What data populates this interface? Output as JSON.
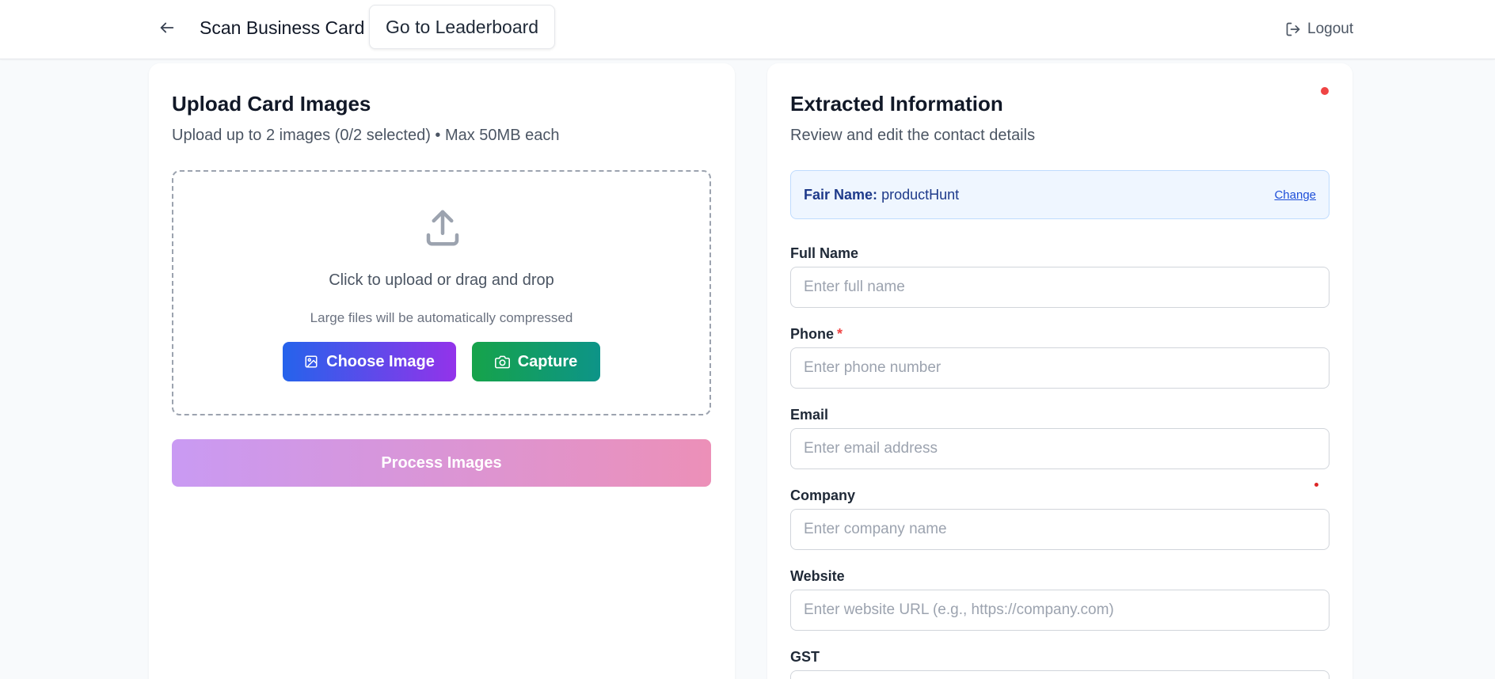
{
  "header": {
    "title": "Scan Business Card",
    "leaderboard_label": "Go to Leaderboard",
    "logout_label": "Logout"
  },
  "upload": {
    "title": "Upload Card Images",
    "subtitle": "Upload up to 2 images (0/2 selected) • Max 50MB each",
    "dropzone_main": "Click to upload or drag and drop",
    "dropzone_hint": "Large files will be automatically compressed",
    "choose_label": "Choose Image",
    "capture_label": "Capture",
    "process_label": "Process Images"
  },
  "extracted": {
    "title": "Extracted Information",
    "subtitle": "Review and edit the contact details",
    "fair_label": "Fair Name:",
    "fair_value": "productHunt",
    "change_label": "Change",
    "fields": [
      {
        "label": "Full Name",
        "placeholder": "Enter full name",
        "value": ""
      },
      {
        "label": "Phone",
        "placeholder": "Enter phone number",
        "value": "",
        "required_mark": "*"
      },
      {
        "label": "Email",
        "placeholder": "Enter email address",
        "value": ""
      },
      {
        "label": "Company",
        "placeholder": "Enter company name",
        "value": ""
      },
      {
        "label": "Website",
        "placeholder": "Enter website URL (e.g., https://company.com)",
        "value": ""
      },
      {
        "label": "GST",
        "placeholder": "",
        "value": ""
      }
    ]
  },
  "colors": {
    "status_dot": "#ef4444",
    "choose_gradient": [
      "#2563eb",
      "#9333ea"
    ],
    "capture_gradient": [
      "#16a34a",
      "#0d9488"
    ],
    "process_gradient": [
      "#c99af3",
      "#ec90b8"
    ]
  },
  "icons": {
    "back": "arrow-left-icon",
    "logout": "logout-icon",
    "upload": "upload-icon",
    "image": "image-icon",
    "camera": "camera-icon"
  }
}
